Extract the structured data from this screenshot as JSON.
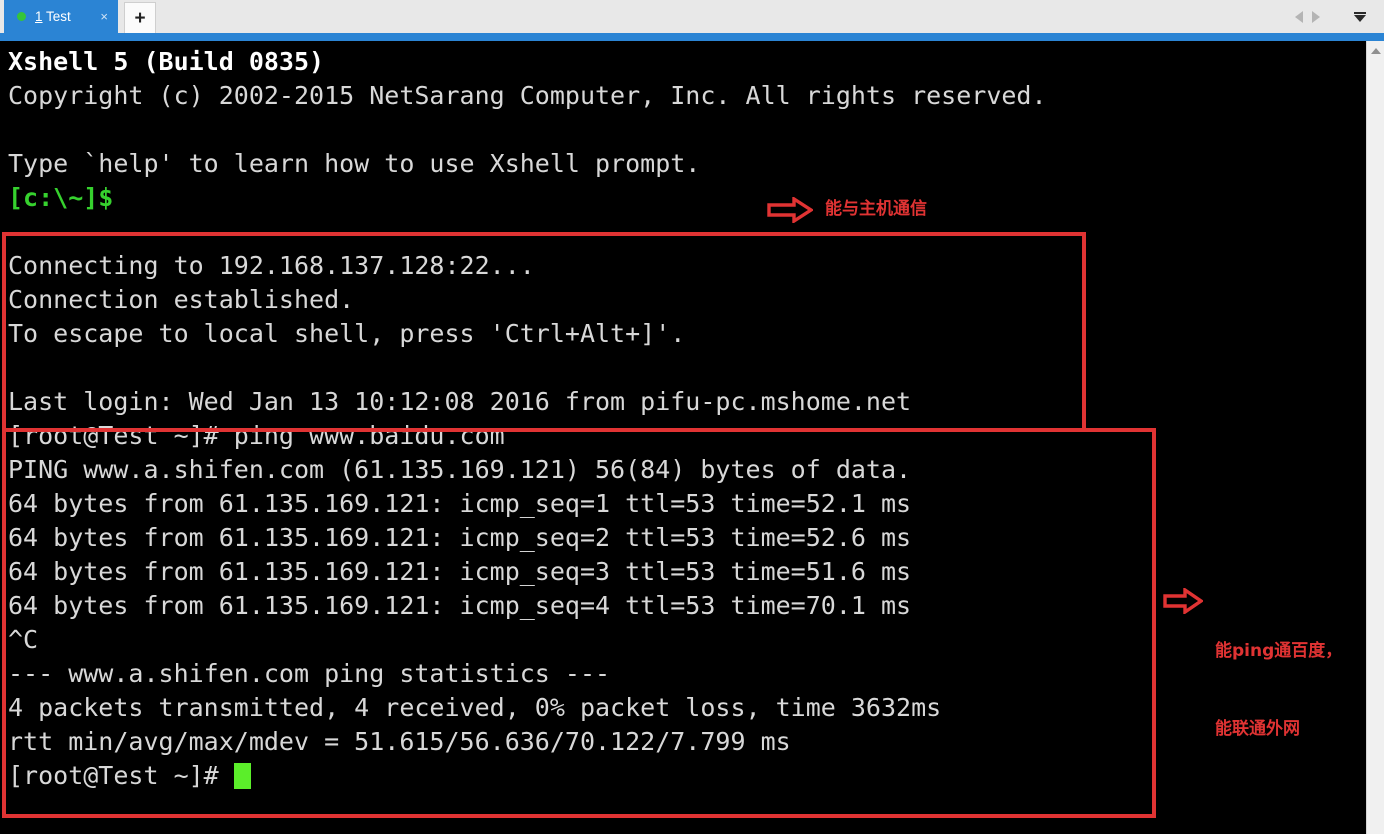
{
  "window": {
    "title": "Xshell 5 (Build 0835)"
  },
  "tabbar": {
    "tab": {
      "number": "1",
      "name": " Test",
      "status_icon": "green-dot",
      "close_label": "×"
    },
    "new_tab_label": "+",
    "nav_prev_icon": "triangle-left-icon",
    "nav_next_icon": "triangle-right-icon",
    "dropdown_icon": "chevron-down-icon"
  },
  "terminal": {
    "lines": [
      {
        "text": "Xshell 5 (Build 0835)",
        "style": "bold"
      },
      {
        "text": "Copyright (c) 2002-2015 NetSarang Computer, Inc. All rights reserved.",
        "style": "normal"
      },
      {
        "text": "",
        "style": "normal"
      },
      {
        "text": "Type `help' to learn how to use Xshell prompt.",
        "style": "normal"
      },
      {
        "text": "[c:\\~]$",
        "style": "green"
      },
      {
        "text": "",
        "style": "normal"
      },
      {
        "text": "Connecting to 192.168.137.128:22...",
        "style": "normal"
      },
      {
        "text": "Connection established.",
        "style": "normal"
      },
      {
        "text": "To escape to local shell, press 'Ctrl+Alt+]'.",
        "style": "normal"
      },
      {
        "text": "",
        "style": "normal"
      },
      {
        "text": "Last login: Wed Jan 13 10:12:08 2016 from pifu-pc.mshome.net",
        "style": "normal"
      },
      {
        "text": "[root@Test ~]# ping www.baidu.com",
        "style": "normal"
      },
      {
        "text": "PING www.a.shifen.com (61.135.169.121) 56(84) bytes of data.",
        "style": "normal"
      },
      {
        "text": "64 bytes from 61.135.169.121: icmp_seq=1 ttl=53 time=52.1 ms",
        "style": "normal"
      },
      {
        "text": "64 bytes from 61.135.169.121: icmp_seq=2 ttl=53 time=52.6 ms",
        "style": "normal"
      },
      {
        "text": "64 bytes from 61.135.169.121: icmp_seq=3 ttl=53 time=51.6 ms",
        "style": "normal"
      },
      {
        "text": "64 bytes from 61.135.169.121: icmp_seq=4 ttl=53 time=70.1 ms",
        "style": "normal"
      },
      {
        "text": "^C",
        "style": "normal"
      },
      {
        "text": "--- www.a.shifen.com ping statistics ---",
        "style": "normal"
      },
      {
        "text": "4 packets transmitted, 4 received, 0% packet loss, time 3632ms",
        "style": "normal"
      },
      {
        "text": "rtt min/avg/max/mdev = 51.615/56.636/70.122/7.799 ms",
        "style": "normal"
      },
      {
        "text": "[root@Test ~]# ",
        "style": "normal",
        "cursor": true
      }
    ]
  },
  "annotations": [
    {
      "arrow_icon": "arrow-right-outline-icon",
      "lines": [
        "能与主机通信"
      ]
    },
    {
      "arrow_icon": "arrow-right-outline-icon",
      "lines": [
        "能ping通百度，",
        "能联通外网"
      ]
    }
  ],
  "colors": {
    "accent_blue": "#2b84d4",
    "annotation_red": "#e03333",
    "prompt_green": "#36d12e",
    "cursor_green": "#5bee2a",
    "terminal_bg": "#000000",
    "terminal_fg": "#d8d8d8"
  },
  "scrollbar": {
    "arrow_up_icon": "triangle-up-icon"
  }
}
